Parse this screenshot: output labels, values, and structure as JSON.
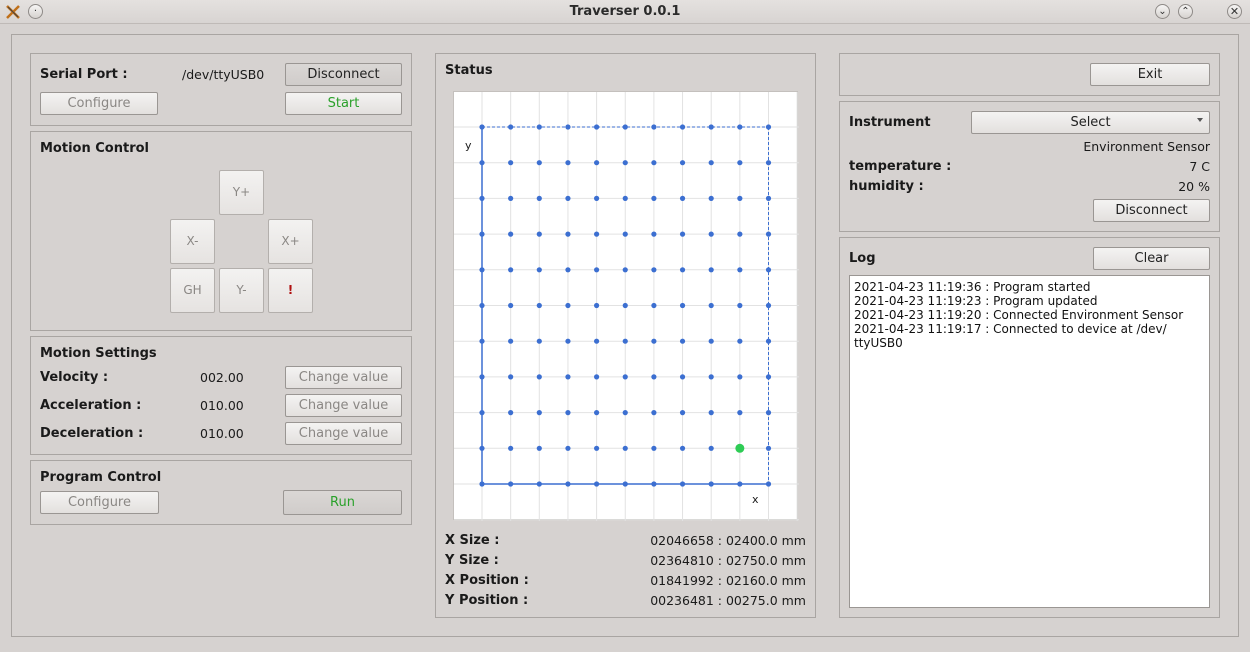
{
  "window": {
    "title": "Traverser 0.0.1",
    "icons": [
      "app-icon",
      "menu-icon",
      "minimize-icon",
      "maximize-icon",
      "close-icon"
    ]
  },
  "serial": {
    "label": "Serial Port :",
    "port": "/dev/ttyUSB0",
    "disconnect": "Disconnect",
    "configure": "Configure",
    "start": "Start"
  },
  "motion_control": {
    "title": "Motion Control",
    "y_plus": "Y+",
    "x_minus": "X-",
    "x_plus": "X+",
    "gh": "GH",
    "y_minus": "Y-",
    "stop": "!"
  },
  "motion_settings": {
    "title": "Motion Settings",
    "rows": [
      {
        "label": "Velocity :",
        "value": "002.00",
        "button": "Change value"
      },
      {
        "label": "Acceleration :",
        "value": "010.00",
        "button": "Change value"
      },
      {
        "label": "Deceleration :",
        "value": "010.00",
        "button": "Change value"
      }
    ]
  },
  "program_control": {
    "title": "Program Control",
    "configure": "Configure",
    "run": "Run"
  },
  "status": {
    "title": "Status",
    "plot": {
      "x_axis_label": "x",
      "y_axis_label": "y",
      "grid_columns": 11,
      "grid_rows": 11,
      "current_col": 9,
      "current_row": 9,
      "point_color": "#3c6fd1",
      "current_color": "#2ecc55"
    },
    "rows": [
      {
        "label": "X Size :",
        "value": "02046658 : 02400.0 mm"
      },
      {
        "label": "Y Size :",
        "value": "02364810 : 02750.0 mm"
      },
      {
        "label": "X Position :",
        "value": "01841992 : 02160.0 mm"
      },
      {
        "label": "Y Position :",
        "value": "00236481 : 00275.0 mm"
      }
    ]
  },
  "exit": "Exit",
  "instrument": {
    "label": "Instrument",
    "select": "Select",
    "name": "Environment Sensor",
    "readings": [
      {
        "label": "temperature :",
        "value": "7 C"
      },
      {
        "label": "humidity :",
        "value": "20 %"
      }
    ],
    "disconnect": "Disconnect"
  },
  "log": {
    "title": "Log",
    "clear": "Clear",
    "entries": [
      "2021-04-23 11:19:36 : Program started",
      "2021-04-23 11:19:23 : Program updated",
      "2021-04-23 11:19:20 : Connected Environment Sensor",
      "2021-04-23 11:19:17 : Connected to device at /dev/\nttyUSB0"
    ]
  }
}
